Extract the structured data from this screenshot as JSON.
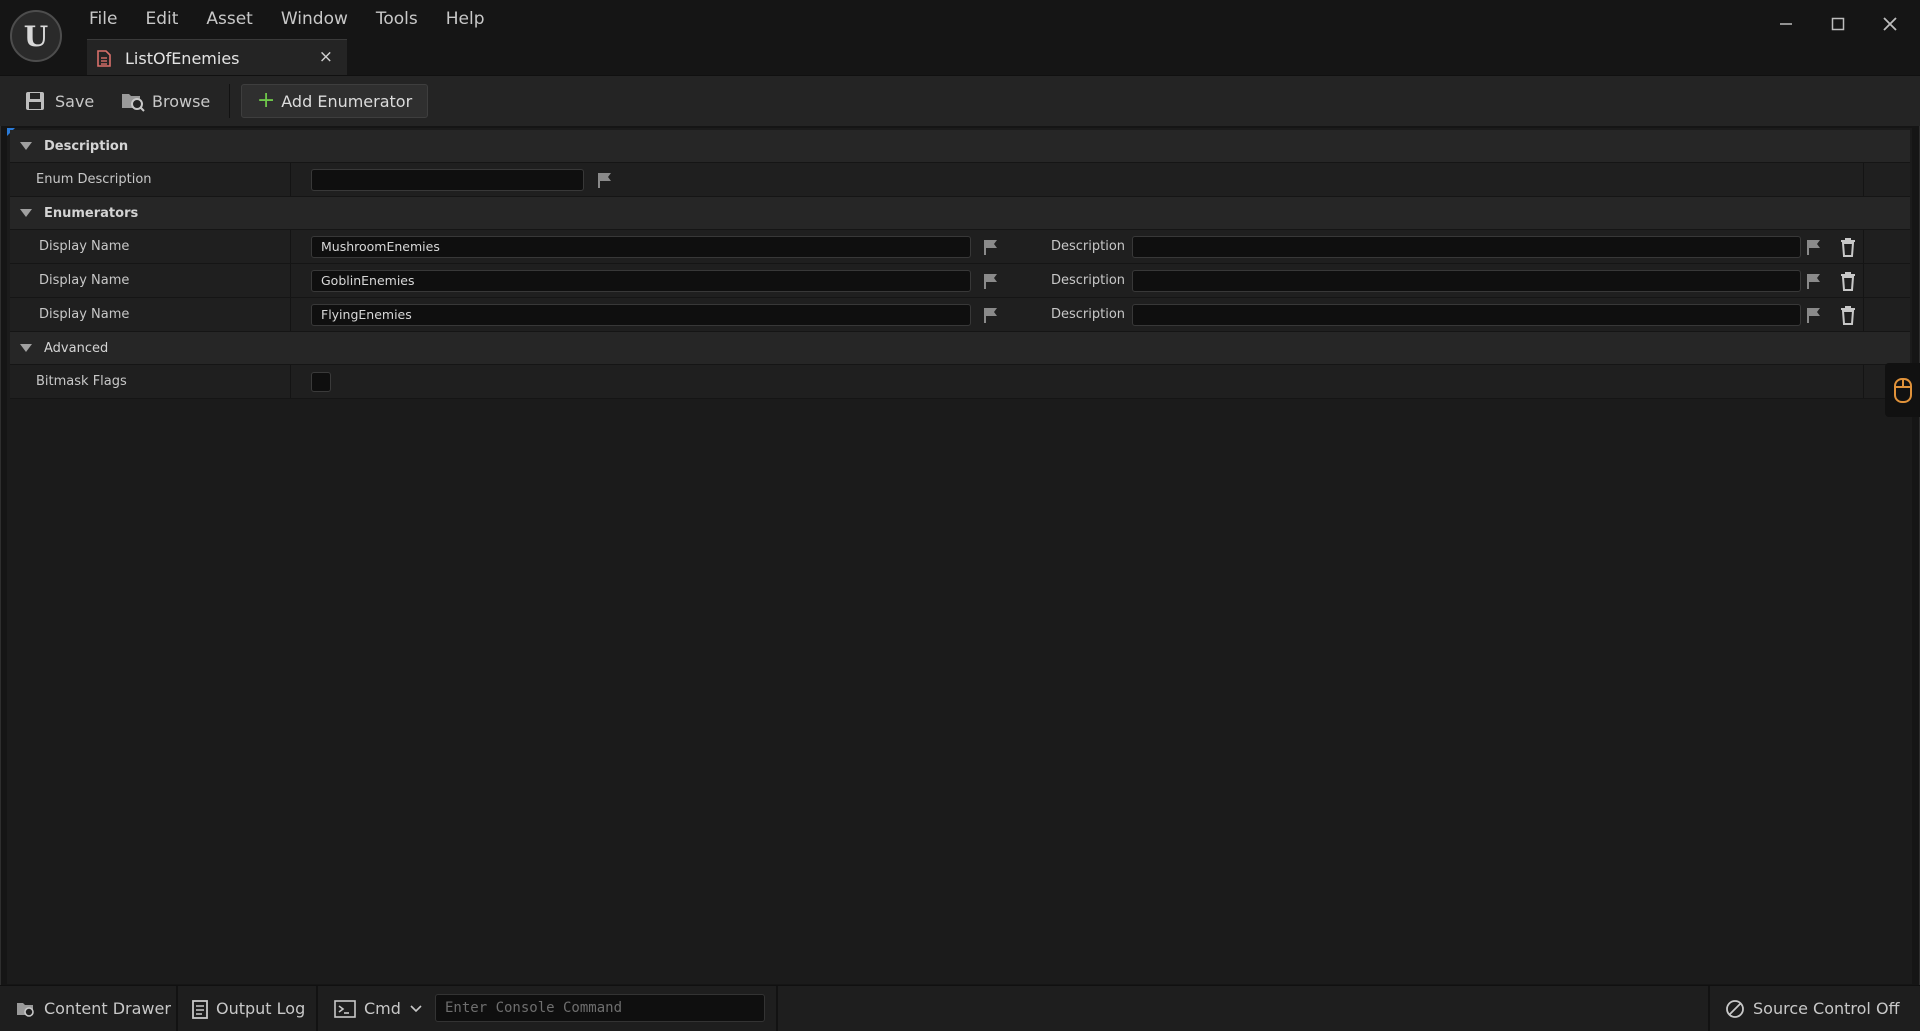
{
  "menu": [
    "File",
    "Edit",
    "Asset",
    "Window",
    "Tools",
    "Help"
  ],
  "tab": {
    "title": "ListOfEnemies",
    "close": "×"
  },
  "toolbar": {
    "save": "Save",
    "browse": "Browse",
    "add": "Add Enumerator"
  },
  "details": {
    "description_category": "Description",
    "enum_description_label": "Enum Description",
    "enum_description_value": "",
    "enumerators_category": "Enumerators",
    "enumerators": [
      {
        "label": "Display Name",
        "value": "MushroomEnemies",
        "desc_label": "Description",
        "desc_value": ""
      },
      {
        "label": "Display Name",
        "value": "GoblinEnemies",
        "desc_label": "Description",
        "desc_value": ""
      },
      {
        "label": "Display Name",
        "value": "FlyingEnemies",
        "desc_label": "Description",
        "desc_value": ""
      }
    ],
    "advanced_category": "Advanced",
    "bitmask_label": "Bitmask Flags",
    "bitmask_checked": false
  },
  "statusbar": {
    "content_drawer": "Content Drawer",
    "output_log": "Output Log",
    "cmd": "Cmd",
    "console_placeholder": "Enter Console Command",
    "source_control": "Source Control Off"
  },
  "colors": {
    "accent_blue": "#2a7bd8",
    "add_green": "#6ec64a",
    "tab_icon_red": "#d9706a"
  }
}
